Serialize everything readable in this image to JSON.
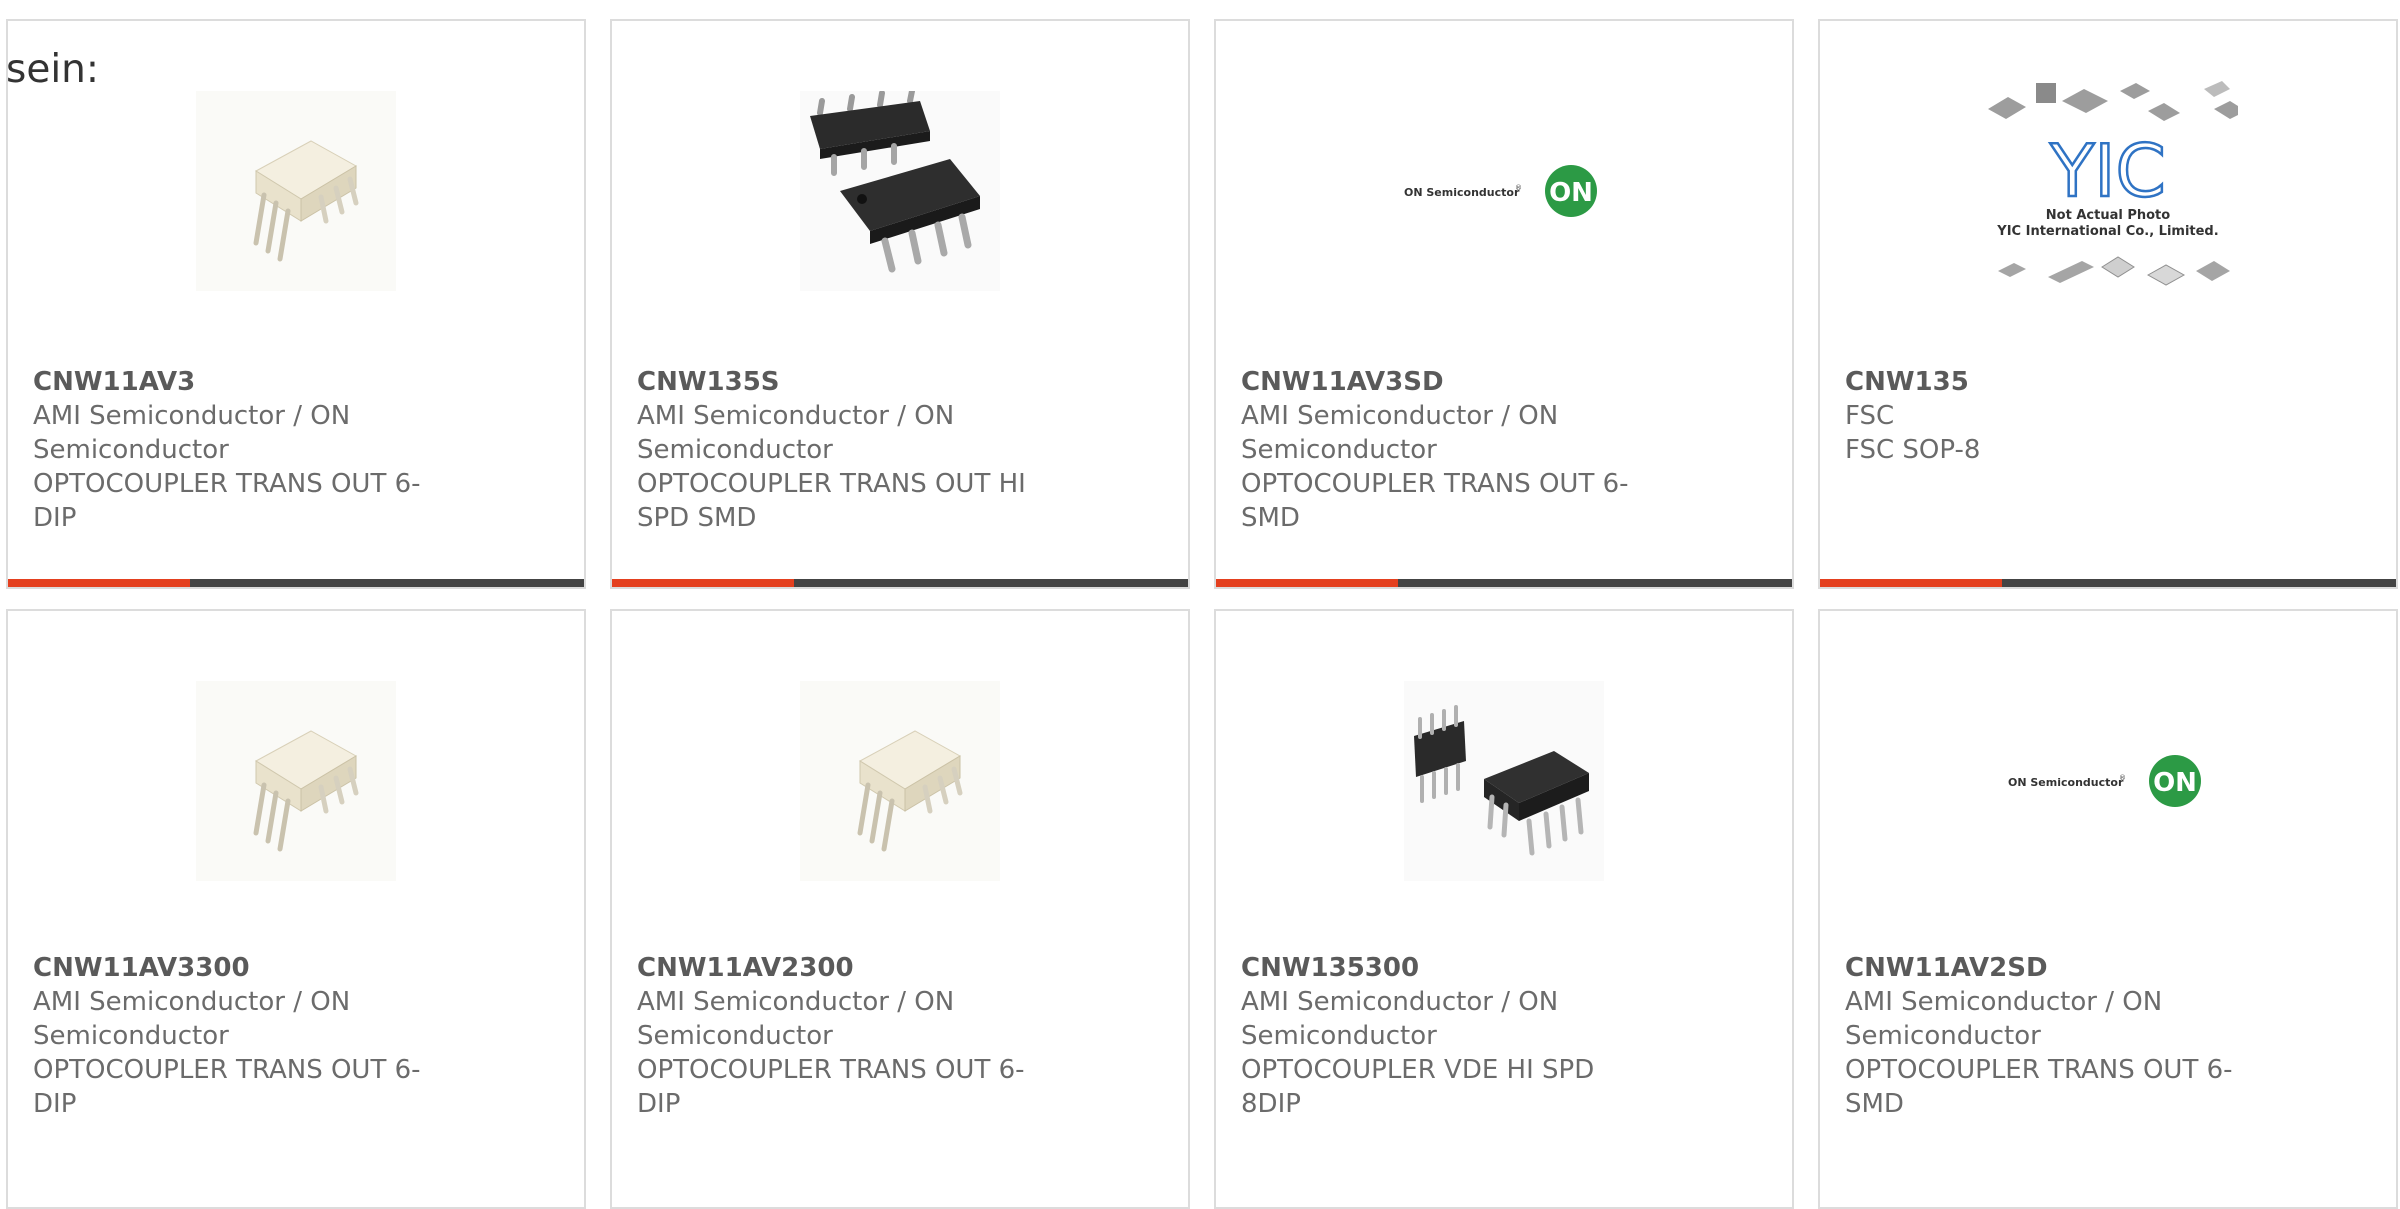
{
  "heading": "sein:",
  "colors": {
    "accent": "#e4401f",
    "bar": "#444444",
    "border": "#dcdcdc"
  },
  "products": [
    {
      "part": "CNW11AV3",
      "manufacturer": "AMI Semiconductor / ON Semiconductor",
      "description": "OPTOCOUPLER TRANS OUT 6-DIP",
      "image": "white-dip6-optocoupler-icon"
    },
    {
      "part": "CNW135S",
      "manufacturer": "AMI Semiconductor / ON Semiconductor",
      "description": "OPTOCOUPLER TRANS OUT HI SPD SMD",
      "image": "black-smd8-chip-icon"
    },
    {
      "part": "CNW11AV3SD",
      "manufacturer": "AMI Semiconductor / ON Semiconductor",
      "description": "OPTOCOUPLER TRANS OUT 6-SMD",
      "image": "on-semiconductor-logo",
      "logo_text": "ON Semiconductor",
      "logo_badge": "ON"
    },
    {
      "part": "CNW135",
      "manufacturer": "FSC",
      "description": "FSC SOP-8",
      "image": "yic-placeholder-photo",
      "logo_text": "YIC",
      "photo_note_1": "Not Actual Photo",
      "photo_note_2": "YIC International Co., Limited."
    },
    {
      "part": "CNW11AV3300",
      "manufacturer": "AMI Semiconductor / ON Semiconductor",
      "description": "OPTOCOUPLER TRANS OUT 6-DIP",
      "image": "white-dip6-optocoupler-icon"
    },
    {
      "part": "CNW11AV2300",
      "manufacturer": "AMI Semiconductor / ON Semiconductor",
      "description": "OPTOCOUPLER TRANS OUT 6-DIP",
      "image": "white-dip6-optocoupler-icon"
    },
    {
      "part": "CNW135300",
      "manufacturer": "AMI Semiconductor / ON Semiconductor",
      "description": "OPTOCOUPLER VDE HI SPD 8DIP",
      "image": "black-dip8-chip-icon"
    },
    {
      "part": "CNW11AV2SD",
      "manufacturer": "AMI Semiconductor / ON Semiconductor",
      "description": "OPTOCOUPLER TRANS OUT 6-SMD",
      "image": "on-semiconductor-logo",
      "logo_text": "ON Semiconductor",
      "logo_badge": "ON"
    }
  ]
}
